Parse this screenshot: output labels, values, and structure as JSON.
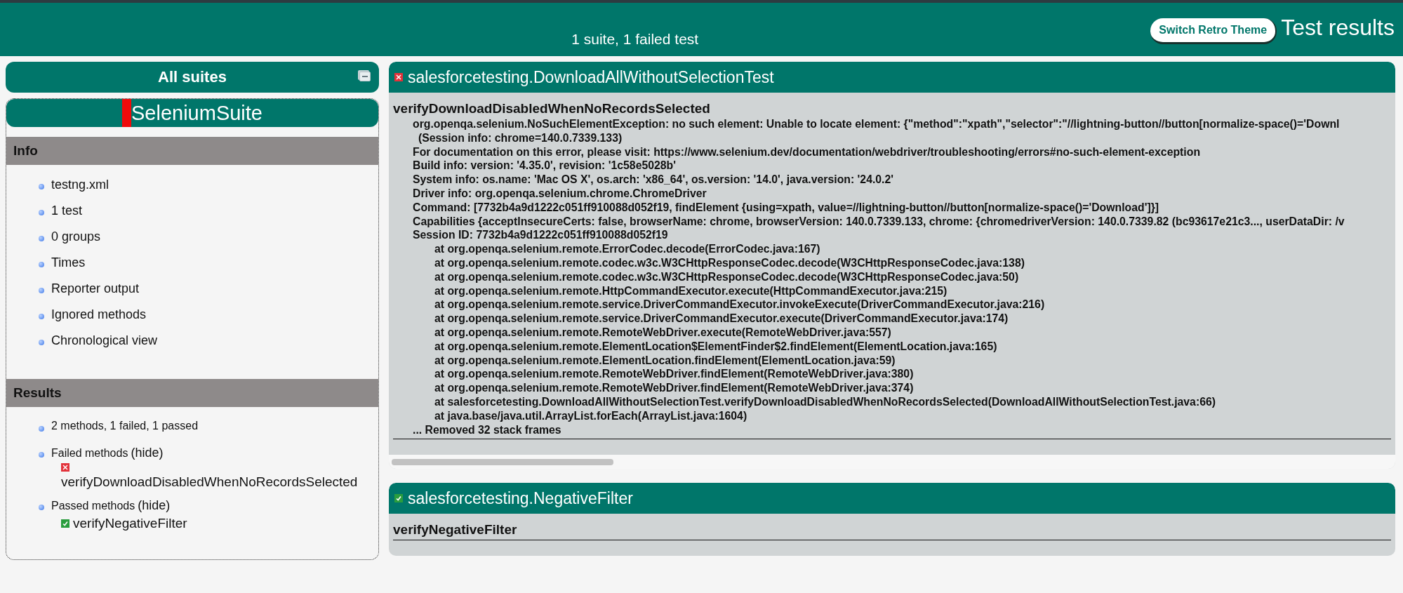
{
  "header": {
    "summary": "1 suite, 1 failed test",
    "theme_button": "Switch Retro Theme",
    "title": "Test results"
  },
  "sidebar": {
    "title": "All suites",
    "suite": {
      "name": "SeleniumSuite",
      "passed": false
    },
    "sections": [
      {
        "title": "Info",
        "items": [
          {
            "kind": "link",
            "label": "testng.xml"
          },
          {
            "kind": "link",
            "label": "1 test"
          },
          {
            "kind": "link",
            "label": "0 groups"
          },
          {
            "kind": "link",
            "label": "Times"
          },
          {
            "kind": "link",
            "label": "Reporter output"
          },
          {
            "kind": "link",
            "label": "Ignored methods"
          },
          {
            "kind": "link",
            "label": "Chronological view"
          }
        ]
      },
      {
        "title": "Results",
        "items": [
          {
            "kind": "text",
            "label": "2 methods, 1 failed, 1 passed"
          },
          {
            "kind": "group",
            "label": "Failed methods",
            "toggle": "(hide)",
            "methods": [
              {
                "name": "verifyDownloadDisabledWhenNoRecordsSelected",
                "passed": false
              }
            ]
          },
          {
            "kind": "group",
            "label": "Passed methods",
            "toggle": "(hide)",
            "methods": [
              {
                "name": "verifyNegativeFilter",
                "passed": true
              }
            ]
          }
        ]
      }
    ]
  },
  "results": [
    {
      "class_name": "salesforcetesting.DownloadAllWithoutSelectionTest",
      "passed": false,
      "scrollbar": true,
      "methods": [
        {
          "name": "verifyDownloadDisabledWhenNoRecordsSelected",
          "output": [
            {
              "kind": "message",
              "text": "org.openqa.selenium.NoSuchElementException: no such element: Unable to locate element: {\"method\":\"xpath\",\"selector\":\"//lightning-button//button[normalize-space()='Downl"
            },
            {
              "kind": "continuation",
              "text": "(Session info: chrome=140.0.7339.133)"
            },
            {
              "kind": "message",
              "text": "For documentation on this error, please visit: https://www.selenium.dev/documentation/webdriver/troubleshooting/errors#no-such-element-exception"
            },
            {
              "kind": "message",
              "text": "Build info: version: '4.35.0', revision: '1c58e5028b'"
            },
            {
              "kind": "message",
              "text": "System info: os.name: 'Mac OS X', os.arch: 'x86_64', os.version: '14.0', java.version: '24.0.2'"
            },
            {
              "kind": "message",
              "text": "Driver info: org.openqa.selenium.chrome.ChromeDriver"
            },
            {
              "kind": "message",
              "text": "Command: [7732b4a9d1222c051ff910088d052f19, findElement {using=xpath, value=//lightning-button//button[normalize-space()='Download']}]"
            },
            {
              "kind": "message",
              "text": "Capabilities {acceptInsecureCerts: false, browserName: chrome, browserVersion: 140.0.7339.133, chrome: {chromedriverVersion: 140.0.7339.82 (bc93617e21c3..., userDataDir: /v"
            },
            {
              "kind": "message",
              "text": "Session ID: 7732b4a9d1222c051ff910088d052f19"
            },
            {
              "kind": "frame",
              "text": "at org.openqa.selenium.remote.ErrorCodec.decode(ErrorCodec.java:167)"
            },
            {
              "kind": "frame",
              "text": "at org.openqa.selenium.remote.codec.w3c.W3CHttpResponseCodec.decode(W3CHttpResponseCodec.java:138)"
            },
            {
              "kind": "frame",
              "text": "at org.openqa.selenium.remote.codec.w3c.W3CHttpResponseCodec.decode(W3CHttpResponseCodec.java:50)"
            },
            {
              "kind": "frame",
              "text": "at org.openqa.selenium.remote.HttpCommandExecutor.execute(HttpCommandExecutor.java:215)"
            },
            {
              "kind": "frame",
              "text": "at org.openqa.selenium.remote.service.DriverCommandExecutor.invokeExecute(DriverCommandExecutor.java:216)"
            },
            {
              "kind": "frame",
              "text": "at org.openqa.selenium.remote.service.DriverCommandExecutor.execute(DriverCommandExecutor.java:174)"
            },
            {
              "kind": "frame",
              "text": "at org.openqa.selenium.remote.RemoteWebDriver.execute(RemoteWebDriver.java:557)"
            },
            {
              "kind": "frame",
              "text": "at org.openqa.selenium.remote.ElementLocation$ElementFinder$2.findElement(ElementLocation.java:165)"
            },
            {
              "kind": "frame",
              "text": "at org.openqa.selenium.remote.ElementLocation.findElement(ElementLocation.java:59)"
            },
            {
              "kind": "frame",
              "text": "at org.openqa.selenium.remote.RemoteWebDriver.findElement(RemoteWebDriver.java:380)"
            },
            {
              "kind": "frame",
              "text": "at org.openqa.selenium.remote.RemoteWebDriver.findElement(RemoteWebDriver.java:374)"
            },
            {
              "kind": "frame",
              "text": "at salesforcetesting.DownloadAllWithoutSelectionTest.verifyDownloadDisabledWhenNoRecordsSelected(DownloadAllWithoutSelectionTest.java:66)"
            },
            {
              "kind": "frame",
              "text": "at java.base/java.util.ArrayList.forEach(ArrayList.java:1604)"
            },
            {
              "kind": "summary",
              "text": "... Removed 32 stack frames"
            }
          ]
        }
      ]
    },
    {
      "class_name": "salesforcetesting.NegativeFilter",
      "passed": true,
      "methods": [
        {
          "name": "verifyNegativeFilter"
        }
      ]
    }
  ]
}
